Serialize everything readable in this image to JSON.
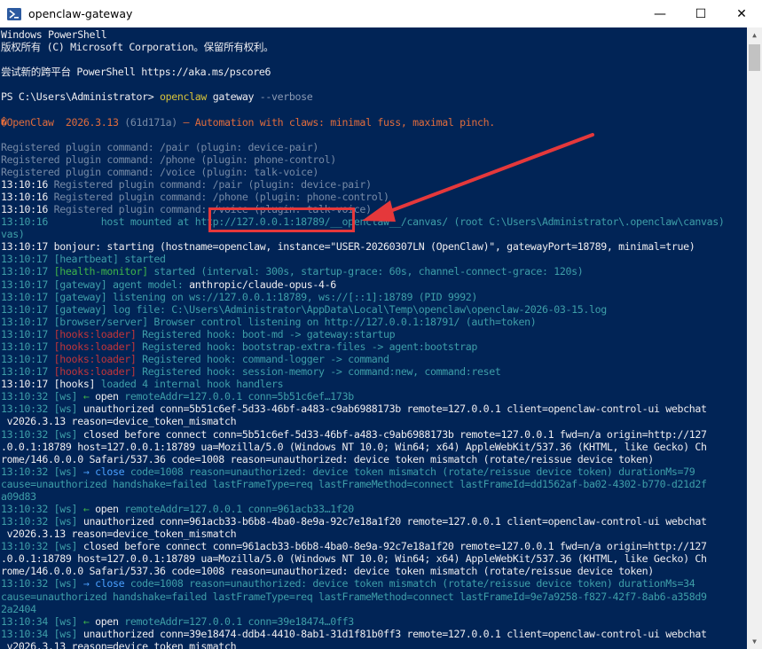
{
  "window": {
    "title": "openclaw-gateway",
    "icon": "powershell-icon",
    "controls": {
      "minimize": "—",
      "maximize": "☐",
      "close": "✕"
    }
  },
  "colors": {
    "console_bg": "#012456",
    "annotation": "#e5383b"
  },
  "console": {
    "lines": [
      [
        {
          "t": "Windows PowerShell",
          "c": "default"
        }
      ],
      [
        {
          "t": "版权所有 (C) Microsoft Corporation。保留所有权利。",
          "c": "default"
        }
      ],
      [
        {
          "t": "",
          "c": "default"
        }
      ],
      [
        {
          "t": "尝试新的跨平台 PowerShell https://aka.ms/pscore6",
          "c": "default"
        }
      ],
      [
        {
          "t": "",
          "c": "default"
        }
      ],
      [
        {
          "t": "PS C:\\Users\\Administrator> ",
          "c": "default"
        },
        {
          "t": "openclaw",
          "c": "yellow"
        },
        {
          "t": " gateway ",
          "c": "default"
        },
        {
          "t": "--verbose",
          "c": "grey"
        }
      ],
      [
        {
          "t": "",
          "c": "default"
        }
      ],
      [
        {
          "t": "�OpenClaw  2026.3.13 ",
          "c": "orange"
        },
        {
          "t": "(61d171a)",
          "c": "dim"
        },
        {
          "t": " — Automation with claws: minimal fuss, maximal pinch.",
          "c": "orange"
        }
      ],
      [
        {
          "t": "",
          "c": "default"
        }
      ],
      [
        {
          "t": "Registered plugin command: /pair (plugin: device-pair)",
          "c": "dim"
        }
      ],
      [
        {
          "t": "Registered plugin command: /phone (plugin: phone-control)",
          "c": "dim"
        }
      ],
      [
        {
          "t": "Registered plugin command: /voice (plugin: talk-voice)",
          "c": "dim"
        }
      ],
      [
        {
          "t": "13:10:16 ",
          "c": "default"
        },
        {
          "t": "Registered plugin command: /pair (plugin: device-pair)",
          "c": "dim"
        }
      ],
      [
        {
          "t": "13:10:16 ",
          "c": "default"
        },
        {
          "t": "Registered plugin command: /phone (plugin: phone-control)",
          "c": "dim"
        }
      ],
      [
        {
          "t": "13:10:16 ",
          "c": "default"
        },
        {
          "t": "Registered plugin command: /voice (plugin: talk-voice)",
          "c": "dim"
        }
      ],
      [
        {
          "t": "13:10:16 ",
          "c": "teal"
        },
        {
          "t": "        host mounted at ",
          "c": "teal"
        },
        {
          "t": "http://127.0.0.1:18789/",
          "c": "teal"
        },
        {
          "t": "__openclaw__/canvas/ (root C:\\Users\\Administrator\\.openclaw\\canvas)",
          "c": "teal"
        }
      ],
      [
        {
          "t": "vas)",
          "c": "teal"
        }
      ],
      [
        {
          "t": "13:10:17 ",
          "c": "default"
        },
        {
          "t": "bonjour: starting (hostname=openclaw, instance=\"USER-20260307LN (OpenClaw)\", gatewayPort=18789, minimal=true)",
          "c": "default"
        }
      ],
      [
        {
          "t": "13:10:17 ",
          "c": "teal"
        },
        {
          "t": "[heartbeat] started",
          "c": "teal"
        }
      ],
      [
        {
          "t": "13:10:17 ",
          "c": "teal"
        },
        {
          "t": "[health-monitor]",
          "c": "green"
        },
        {
          "t": " started (interval: 300s, startup-grace: 60s, channel-connect-grace: 120s)",
          "c": "teal"
        }
      ],
      [
        {
          "t": "13:10:17 ",
          "c": "teal"
        },
        {
          "t": "[gateway]",
          "c": "teal"
        },
        {
          "t": " agent model: ",
          "c": "teal"
        },
        {
          "t": "anthropic/claude-opus-4-6",
          "c": "default"
        }
      ],
      [
        {
          "t": "13:10:17 ",
          "c": "teal"
        },
        {
          "t": "[gateway]",
          "c": "teal"
        },
        {
          "t": " listening on ws://127.0.0.1:18789, ws://[::1]:18789 (PID 9992)",
          "c": "teal"
        }
      ],
      [
        {
          "t": "13:10:17 ",
          "c": "teal"
        },
        {
          "t": "[gateway]",
          "c": "teal"
        },
        {
          "t": " log file: C:\\Users\\Administrator\\AppData\\Local\\Temp\\openclaw\\openclaw-2026-03-15.log",
          "c": "teal"
        }
      ],
      [
        {
          "t": "13:10:17 ",
          "c": "teal"
        },
        {
          "t": "[browser/server]",
          "c": "teal"
        },
        {
          "t": " Browser control listening on http://127.0.0.1:18791/ (auth=token)",
          "c": "teal"
        }
      ],
      [
        {
          "t": "13:10:17 ",
          "c": "teal"
        },
        {
          "t": "[hooks:loader]",
          "c": "red"
        },
        {
          "t": " Registered hook: boot-md -> gateway:startup",
          "c": "teal"
        }
      ],
      [
        {
          "t": "13:10:17 ",
          "c": "teal"
        },
        {
          "t": "[hooks:loader]",
          "c": "red"
        },
        {
          "t": " Registered hook: bootstrap-extra-files -> agent:bootstrap",
          "c": "teal"
        }
      ],
      [
        {
          "t": "13:10:17 ",
          "c": "teal"
        },
        {
          "t": "[hooks:loader]",
          "c": "red"
        },
        {
          "t": " Registered hook: command-logger -> command",
          "c": "teal"
        }
      ],
      [
        {
          "t": "13:10:17 ",
          "c": "teal"
        },
        {
          "t": "[hooks:loader]",
          "c": "red"
        },
        {
          "t": " Registered hook: session-memory -> command:new, command:reset",
          "c": "teal"
        }
      ],
      [
        {
          "t": "13:10:17 ",
          "c": "default"
        },
        {
          "t": "[hooks]",
          "c": "default"
        },
        {
          "t": " loaded 4 internal hook handlers",
          "c": "teal"
        }
      ],
      [
        {
          "t": "13:10:32 ",
          "c": "teal"
        },
        {
          "t": "[ws]",
          "c": "teal"
        },
        {
          "t": " ← ",
          "c": "green"
        },
        {
          "t": "open",
          "c": "default"
        },
        {
          "t": " remoteAddr=127.0.0.1 conn=5b51c6ef…173b",
          "c": "teal"
        }
      ],
      [
        {
          "t": "13:10:32 ",
          "c": "teal"
        },
        {
          "t": "[ws]",
          "c": "teal"
        },
        {
          "t": " unauthorized conn=5b51c6ef-5d33-46bf-a483-c9ab6988173b remote=127.0.0.1 client=openclaw-control-ui webchat",
          "c": "default"
        }
      ],
      [
        {
          "t": " v2026.3.13 reason=device_token_mismatch",
          "c": "default"
        }
      ],
      [
        {
          "t": "13:10:32 ",
          "c": "teal"
        },
        {
          "t": "[ws]",
          "c": "teal"
        },
        {
          "t": " closed before connect conn=5b51c6ef-5d33-46bf-a483-c9ab6988173b remote=127.0.0.1 fwd=n/a origin=http://127",
          "c": "default"
        }
      ],
      [
        {
          "t": ".0.0.1:18789 host=127.0.0.1:18789 ua=Mozilla/5.0 (Windows NT 10.0; Win64; x64) AppleWebKit/537.36 (KHTML, like Gecko) Ch",
          "c": "default"
        }
      ],
      [
        {
          "t": "rome/146.0.0.0 Safari/537.36 code=1008 reason=unauthorized: device token mismatch (rotate/reissue device token)",
          "c": "default"
        }
      ],
      [
        {
          "t": "13:10:32 ",
          "c": "teal"
        },
        {
          "t": "[ws]",
          "c": "teal"
        },
        {
          "t": " → ",
          "c": "blue"
        },
        {
          "t": "close",
          "c": "blue"
        },
        {
          "t": " code=1008 reason=unauthorized: device token mismatch (rotate/reissue device token) durationMs=79",
          "c": "teal"
        }
      ],
      [
        {
          "t": "cause=unauthorized handshake=failed lastFrameType=req lastFrameMethod=connect lastFrameId=dd1562af-ba02-4302-b770-d21d2f",
          "c": "teal"
        }
      ],
      [
        {
          "t": "a09d83",
          "c": "teal"
        }
      ],
      [
        {
          "t": "13:10:32 ",
          "c": "teal"
        },
        {
          "t": "[ws]",
          "c": "teal"
        },
        {
          "t": " ← ",
          "c": "green"
        },
        {
          "t": "open",
          "c": "default"
        },
        {
          "t": " remoteAddr=127.0.0.1 conn=961acb33…1f20",
          "c": "teal"
        }
      ],
      [
        {
          "t": "13:10:32 ",
          "c": "teal"
        },
        {
          "t": "[ws]",
          "c": "teal"
        },
        {
          "t": " unauthorized conn=961acb33-b6b8-4ba0-8e9a-92c7e18a1f20 remote=127.0.0.1 client=openclaw-control-ui webchat",
          "c": "default"
        }
      ],
      [
        {
          "t": " v2026.3.13 reason=device_token_mismatch",
          "c": "default"
        }
      ],
      [
        {
          "t": "13:10:32 ",
          "c": "teal"
        },
        {
          "t": "[ws]",
          "c": "teal"
        },
        {
          "t": " closed before connect conn=961acb33-b6b8-4ba0-8e9a-92c7e18a1f20 remote=127.0.0.1 fwd=n/a origin=http://127",
          "c": "default"
        }
      ],
      [
        {
          "t": ".0.0.1:18789 host=127.0.0.1:18789 ua=Mozilla/5.0 (Windows NT 10.0; Win64; x64) AppleWebKit/537.36 (KHTML, like Gecko) Ch",
          "c": "default"
        }
      ],
      [
        {
          "t": "rome/146.0.0.0 Safari/537.36 code=1008 reason=unauthorized: device token mismatch (rotate/reissue device token)",
          "c": "default"
        }
      ],
      [
        {
          "t": "13:10:32 ",
          "c": "teal"
        },
        {
          "t": "[ws]",
          "c": "teal"
        },
        {
          "t": " → ",
          "c": "blue"
        },
        {
          "t": "close",
          "c": "blue"
        },
        {
          "t": " code=1008 reason=unauthorized: device token mismatch (rotate/reissue device token) durationMs=34",
          "c": "teal"
        }
      ],
      [
        {
          "t": "cause=unauthorized handshake=failed lastFrameType=req lastFrameMethod=connect lastFrameId=9e7a9258-f827-42f7-8ab6-a358d9",
          "c": "teal"
        }
      ],
      [
        {
          "t": "2a2404",
          "c": "teal"
        }
      ],
      [
        {
          "t": "13:10:34 ",
          "c": "teal"
        },
        {
          "t": "[ws]",
          "c": "teal"
        },
        {
          "t": " ← ",
          "c": "green"
        },
        {
          "t": "open",
          "c": "default"
        },
        {
          "t": " remoteAddr=127.0.0.1 conn=39e18474…0ff3",
          "c": "teal"
        }
      ],
      [
        {
          "t": "13:10:34 ",
          "c": "teal"
        },
        {
          "t": "[ws]",
          "c": "teal"
        },
        {
          "t": " unauthorized conn=39e18474-ddb4-4410-8ab1-31d1f81b0ff3 remote=127.0.0.1 client=openclaw-control-ui webchat",
          "c": "default"
        }
      ],
      [
        {
          "t": " v2026.3.13 reason=device_token_mismatch",
          "c": "default"
        }
      ]
    ]
  }
}
